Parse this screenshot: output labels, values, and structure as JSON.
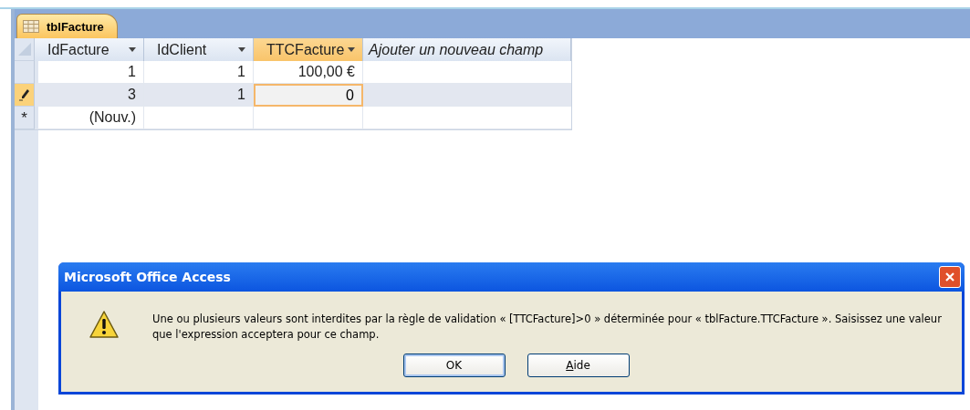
{
  "tab": {
    "label": "tblFacture",
    "selected": true
  },
  "columns": [
    {
      "label": "IdFacture",
      "kind": "field",
      "selected": false
    },
    {
      "label": "IdClient",
      "kind": "field",
      "selected": false
    },
    {
      "label": "TTCFacture",
      "kind": "field",
      "selected": true
    },
    {
      "label": "Ajouter un nouveau champ",
      "kind": "add",
      "selected": false
    }
  ],
  "rows": [
    {
      "kind": "record",
      "current": false,
      "cells": [
        {
          "text": "1",
          "selected": false
        },
        {
          "text": "1",
          "selected": false
        },
        {
          "text": "100,00 €",
          "selected": false
        }
      ]
    },
    {
      "kind": "editing",
      "current": true,
      "cells": [
        {
          "text": "3",
          "selected": false
        },
        {
          "text": "1",
          "selected": false
        },
        {
          "text": "0",
          "selected": true
        }
      ]
    },
    {
      "kind": "new",
      "current": false,
      "marker": "*",
      "cells": [
        {
          "text": "(Nouv.)"
        }
      ]
    }
  ],
  "dialog": {
    "title": "Microsoft Office Access",
    "message": "Une ou plusieurs valeurs sont interdites par la règle de validation « [TTCFacture]>0 » déterminée pour « tblFacture.TTCFacture ». Saisissez une valeur que l'expression acceptera pour ce champ.",
    "buttons": [
      {
        "label": "OK",
        "selected": true
      },
      {
        "label": "Aide",
        "selected": false
      }
    ]
  }
}
